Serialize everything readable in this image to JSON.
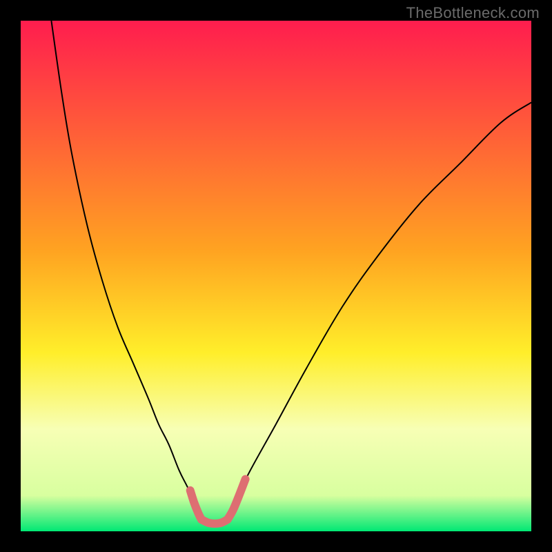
{
  "watermark": "TheBottleneck.com",
  "chart_data": {
    "type": "line",
    "title": "",
    "xlabel": "",
    "ylabel": "",
    "xlim": [
      0,
      100
    ],
    "ylim": [
      0,
      100
    ],
    "background_gradient": {
      "stops": [
        {
          "offset": 0,
          "color": "#ff1d4e"
        },
        {
          "offset": 45,
          "color": "#ffa321"
        },
        {
          "offset": 65,
          "color": "#ffee2a"
        },
        {
          "offset": 80,
          "color": "#f7ffb5"
        },
        {
          "offset": 93,
          "color": "#d8ff9f"
        },
        {
          "offset": 100,
          "color": "#00e874"
        }
      ]
    },
    "series": [
      {
        "name": "left-branch",
        "stroke": "#000000",
        "stroke_width": 2,
        "x": [
          6,
          8,
          10,
          13,
          16,
          19,
          22,
          25,
          27,
          29,
          31,
          32.5,
          34,
          35,
          36
        ],
        "y": [
          100,
          86,
          74,
          60,
          49,
          40,
          33,
          26,
          21,
          17,
          12,
          9,
          6,
          4,
          2
        ]
      },
      {
        "name": "right-branch",
        "stroke": "#000000",
        "stroke_width": 2,
        "x": [
          40,
          42,
          45,
          50,
          56,
          63,
          70,
          78,
          86,
          94,
          100
        ],
        "y": [
          2,
          6,
          12,
          21,
          32,
          44,
          54,
          64,
          72,
          80,
          84
        ]
      },
      {
        "name": "highlight-left-knee",
        "stroke": "#de6e72",
        "stroke_width": 12,
        "linecap": "round",
        "x": [
          33.2,
          34.0,
          34.8,
          35.4
        ],
        "y": [
          8.0,
          5.5,
          3.5,
          2.3
        ]
      },
      {
        "name": "highlight-valley",
        "stroke": "#de6e72",
        "stroke_width": 12,
        "linecap": "round",
        "x": [
          35.4,
          37.0,
          39.0,
          40.5
        ],
        "y": [
          2.3,
          1.6,
          1.6,
          2.3
        ]
      },
      {
        "name": "highlight-right-knee",
        "stroke": "#de6e72",
        "stroke_width": 12,
        "linecap": "round",
        "x": [
          40.5,
          41.6,
          42.8,
          44.0
        ],
        "y": [
          2.3,
          4.2,
          7.1,
          10.2
        ]
      }
    ]
  }
}
